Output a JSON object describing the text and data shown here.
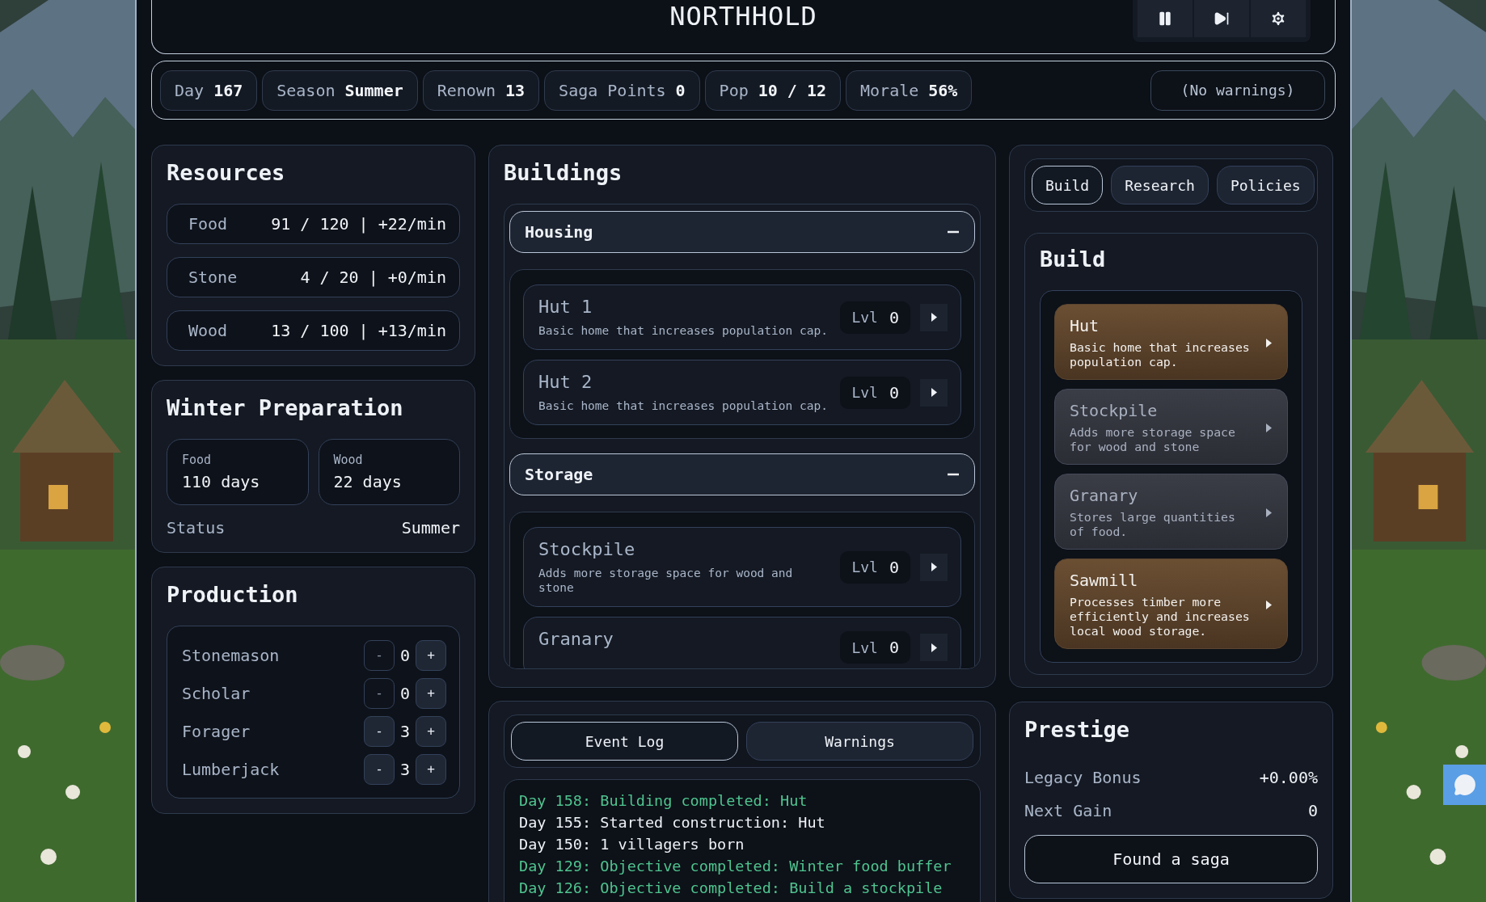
{
  "header": {
    "title": "NORTHHOLD",
    "controls": [
      {
        "kind": "pause"
      },
      {
        "kind": "fast_forward"
      },
      {
        "kind": "settings"
      }
    ]
  },
  "stats": [
    {
      "label": "Day",
      "value": "167"
    },
    {
      "label": "Season",
      "value": "Summer"
    },
    {
      "label": "Renown",
      "value": "13"
    },
    {
      "label": "Saga Points",
      "value": "0"
    },
    {
      "label": "Pop",
      "value": "10 / 12"
    },
    {
      "label": "Morale",
      "value": "56%"
    }
  ],
  "warnings_badge": "(No warnings)",
  "resources": {
    "title": "Resources",
    "rows": [
      {
        "name": "Food",
        "value": "91 / 120 | +22/min"
      },
      {
        "name": "Stone",
        "value": "4 / 20 | +0/min"
      },
      {
        "name": "Wood",
        "value": "13 / 100 | +13/min"
      }
    ]
  },
  "winter": {
    "title": "Winter Preparation",
    "cards": [
      {
        "label": "Food",
        "value": "110 days"
      },
      {
        "label": "Wood",
        "value": "22 days"
      }
    ],
    "status_label": "Status",
    "status_value": "Summer"
  },
  "production": {
    "title": "Production",
    "jobs": [
      {
        "name": "Stonemason",
        "count": "0",
        "minus": "-",
        "plus": "+",
        "minus_disabled": true
      },
      {
        "name": "Scholar",
        "count": "0",
        "minus": "-",
        "plus": "+",
        "minus_disabled": true
      },
      {
        "name": "Forager",
        "count": "3",
        "minus": "-",
        "plus": "+",
        "minus_disabled": false
      },
      {
        "name": "Lumberjack",
        "count": "3",
        "minus": "-",
        "plus": "+",
        "minus_disabled": false
      }
    ]
  },
  "buildings": {
    "title": "Buildings",
    "groups": [
      {
        "name": "Housing",
        "expanded": true,
        "items": [
          {
            "name": "Hut 1",
            "description": "Basic home that increases population cap.",
            "lvl_label": "Lvl",
            "lvl_value": "0"
          },
          {
            "name": "Hut 2",
            "description": "Basic home that increases population cap.",
            "lvl_label": "Lvl",
            "lvl_value": "0"
          }
        ]
      },
      {
        "name": "Storage",
        "expanded": true,
        "items": [
          {
            "name": "Stockpile",
            "description": "Adds more storage space for wood and stone",
            "lvl_label": "Lvl",
            "lvl_value": "0"
          },
          {
            "name": "Granary",
            "lvl_label": "Lvl",
            "lvl_value": "0"
          }
        ]
      }
    ]
  },
  "log": {
    "tabs": [
      {
        "label": "Event Log",
        "selected": true
      },
      {
        "label": "Warnings",
        "selected": false
      }
    ],
    "entries": [
      {
        "text": "Day 158: Building completed: Hut",
        "kind": "success"
      },
      {
        "text": "Day 155: Started construction: Hut",
        "kind": "info"
      },
      {
        "text": "Day 150: 1 villagers born",
        "kind": "info"
      },
      {
        "text": "Day 129: Objective completed: Winter food buffer",
        "kind": "success"
      },
      {
        "text": "Day 126: Objective completed: Build a stockpile",
        "kind": "success"
      }
    ]
  },
  "side": {
    "tabs": [
      {
        "label": "Build",
        "selected": true
      },
      {
        "label": "Research",
        "selected": false
      },
      {
        "label": "Policies",
        "selected": false
      }
    ],
    "section_title": "Build",
    "items": [
      {
        "name": "Hut",
        "description": "Basic home that increases population cap.",
        "affordable": true
      },
      {
        "name": "Stockpile",
        "description": "Adds more storage space for wood and stone",
        "affordable": false
      },
      {
        "name": "Granary",
        "description": "Stores large quantities of food.",
        "affordable": false
      },
      {
        "name": "Sawmill",
        "description": "Processes timber more efficiently and increases local wood storage.",
        "affordable": true
      }
    ]
  },
  "prestige": {
    "title": "Prestige",
    "rows": [
      {
        "label": "Legacy Bonus",
        "value": "+0.00%"
      },
      {
        "label": "Next Gain",
        "value": "0"
      }
    ],
    "button": "Found a saga"
  }
}
